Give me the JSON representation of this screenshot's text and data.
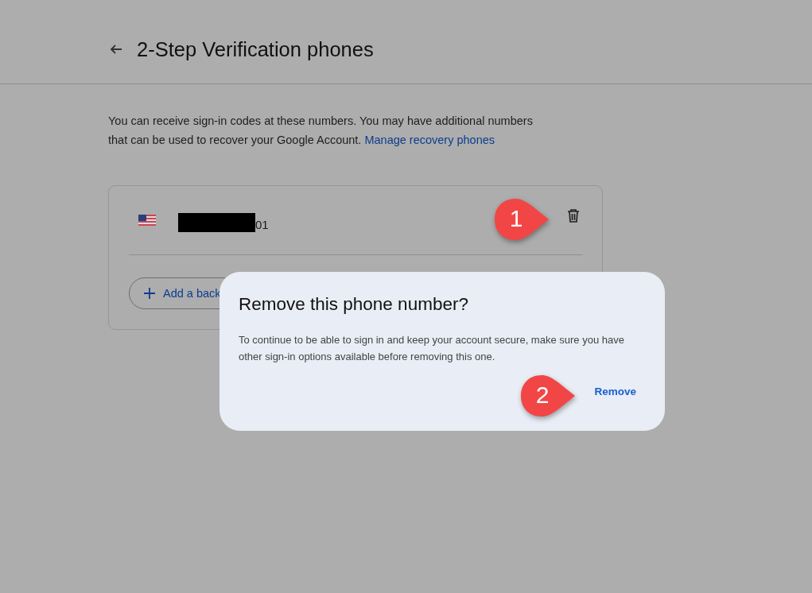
{
  "header": {
    "title": "2-Step Verification phones"
  },
  "intro": {
    "text": "You can receive sign-in codes at these numbers. You may have additional numbers that can be used to recover your Google Account. ",
    "link": "Manage recovery phones"
  },
  "phones": [
    {
      "number_visible": "01",
      "redacted": true
    }
  ],
  "add_button": {
    "label": "Add a back"
  },
  "dialog": {
    "title": "Remove this phone number?",
    "body": "To continue to be able to sign in and keep your account secure, make sure you have other sign-in options available before removing this one.",
    "buttons": [
      "Remove"
    ]
  },
  "callouts": [
    {
      "label": "1"
    },
    {
      "label": "2"
    }
  ]
}
